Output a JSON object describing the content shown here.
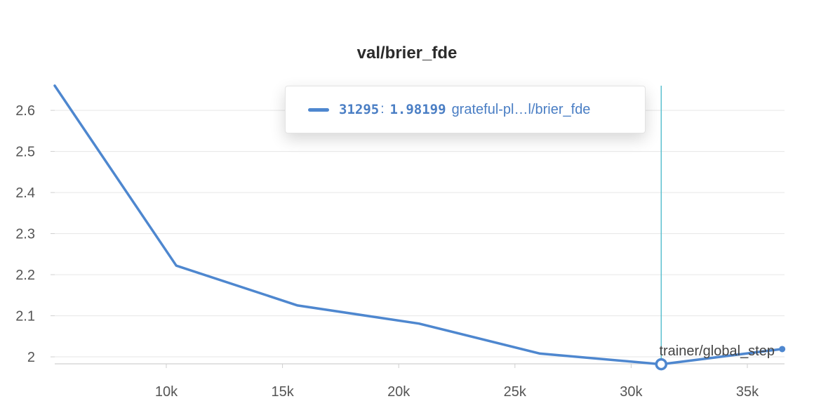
{
  "chart_data": {
    "type": "line",
    "title": "val/brier_fde",
    "xlabel": "trainer/global_step",
    "ylabel": "",
    "xlim": [
      5200,
      36600
    ],
    "ylim": [
      1.983,
      2.66
    ],
    "x_ticks": [
      10000,
      15000,
      20000,
      25000,
      30000,
      35000
    ],
    "x_tick_labels": [
      "10k",
      "15k",
      "20k",
      "25k",
      "30k",
      "35k"
    ],
    "y_ticks": [
      2.0,
      2.1,
      2.2,
      2.3,
      2.4,
      2.5,
      2.6
    ],
    "y_tick_labels": [
      "2",
      "2.1",
      "2.2",
      "2.3",
      "2.4",
      "2.5",
      "2.6"
    ],
    "grid": true,
    "series": [
      {
        "name": "grateful-pl…l/brier_fde",
        "color": "#4e87cf",
        "x": [
          5200,
          10430,
          15650,
          20870,
          26080,
          31295,
          36500
        ],
        "y": [
          2.66,
          2.222,
          2.125,
          2.081,
          2.008,
          1.98199,
          2.019
        ]
      }
    ],
    "hover": {
      "step": "31295",
      "separator": ":",
      "value": "1.98199",
      "run": "grateful-pl…l/brier_fde",
      "x": 31295,
      "y": 1.98199
    },
    "colors": {
      "line": "#4e87cf",
      "hover_line": "#5bc0cf",
      "grid": "#e6e6e6"
    }
  }
}
